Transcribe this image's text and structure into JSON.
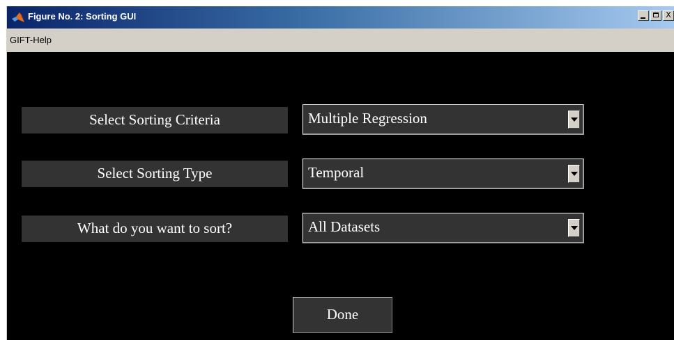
{
  "window": {
    "title": "Figure No. 2: Sorting GUI",
    "icon": "matlab-icon",
    "controls": {
      "minimize_icon": "minimize-icon",
      "maximize_icon": "maximize-icon",
      "close_label": "X"
    }
  },
  "menubar": {
    "items": [
      {
        "label": "GIFT-Help"
      }
    ]
  },
  "form": {
    "rows": [
      {
        "label": "Select Sorting Criteria",
        "value": "Multiple Regression"
      },
      {
        "label": "Select Sorting Type",
        "value": "Temporal"
      },
      {
        "label": "What do you want to sort?",
        "value": "All Datasets"
      }
    ]
  },
  "done_button": {
    "label": "Done"
  },
  "colors": {
    "background": "#000000",
    "control": "#333333",
    "text": "#ffffff",
    "chrome": "#d4d0c8",
    "titlebar": "#0a246a"
  }
}
